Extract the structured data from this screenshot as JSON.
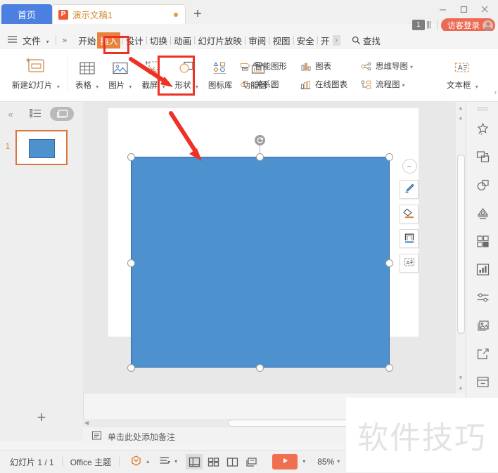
{
  "window": {
    "tabs": [
      {
        "label": "首页",
        "type": "home"
      },
      {
        "label": "演示文稿1",
        "type": "document",
        "icon": "wps-presentation-icon"
      }
    ],
    "new_tab_label": "+",
    "controls": {
      "minimize": "—",
      "maximize": "▢",
      "close": "✕"
    },
    "account_badge": "1",
    "login_label": "访客登录"
  },
  "menubar": {
    "file_label": "文件",
    "overflow_label": "»",
    "ribbon_tabs": [
      {
        "label": "开始",
        "selected": false
      },
      {
        "label": "插入",
        "selected": true
      },
      {
        "label": "设计",
        "selected": false
      },
      {
        "label": "切换",
        "selected": false
      },
      {
        "label": "动画",
        "selected": false
      },
      {
        "label": "幻灯片放映",
        "selected": false
      },
      {
        "label": "审阅",
        "selected": false
      },
      {
        "label": "视图",
        "selected": false
      },
      {
        "label": "安全",
        "selected": false
      },
      {
        "label": "开",
        "selected": false
      }
    ],
    "more_tabs_label": "›",
    "find_label": "查找",
    "right_icons": [
      "cloud-sync-icon",
      "share-icon",
      "collaborate-icon",
      "help-icon",
      "more-icon",
      "collapse-ribbon-icon"
    ]
  },
  "ribbon": {
    "groups": [
      {
        "items": [
          {
            "label": "新建幻灯片",
            "icon": "new-slide-icon",
            "dropdown": true,
            "size": "big"
          }
        ]
      },
      {
        "items": [
          {
            "label": "表格",
            "icon": "table-icon",
            "dropdown": true,
            "size": "big"
          },
          {
            "label": "图片",
            "icon": "picture-icon",
            "dropdown": true,
            "size": "big"
          },
          {
            "label": "截屏",
            "icon": "screenshot-icon",
            "dropdown": true,
            "size": "big"
          },
          {
            "label": "形状",
            "icon": "shapes-icon",
            "dropdown": true,
            "size": "big",
            "highlighted": true
          },
          {
            "label": "图标库",
            "icon": "icon-library-icon",
            "dropdown": false,
            "size": "big"
          },
          {
            "label": "功能图",
            "icon": "function-chart-icon",
            "dropdown": true,
            "size": "big"
          }
        ]
      },
      {
        "items": [
          {
            "label": "智能图形",
            "icon": "smartart-icon",
            "size": "small"
          },
          {
            "label": "关系图",
            "icon": "relationship-chart-icon",
            "size": "small"
          },
          {
            "label": "图表",
            "icon": "chart-icon",
            "size": "small"
          },
          {
            "label": "在线图表",
            "icon": "online-chart-icon",
            "size": "small"
          },
          {
            "label": "思维导图",
            "icon": "mindmap-icon",
            "dropdown": true,
            "size": "small"
          },
          {
            "label": "流程图",
            "icon": "flowchart-icon",
            "dropdown": true,
            "size": "small"
          },
          {
            "label": "文本框",
            "icon": "textbox-icon",
            "dropdown": true,
            "size": "big"
          }
        ]
      }
    ],
    "expand_label": "›"
  },
  "slide_panel": {
    "collapse_label": "«",
    "outline_icon": "outline-view-icon",
    "slides_icon": "slides-view-icon",
    "slides": [
      {
        "number": "1",
        "selected": true
      }
    ],
    "add_slide_label": "+"
  },
  "canvas": {
    "shape": {
      "name": "rectangle",
      "fill": "#4e91cf",
      "stroke": "#2d6ca3"
    },
    "rotate_handle_icon": "rotate-icon",
    "mini_toolbar": {
      "close_label": "−",
      "buttons": [
        {
          "icon": "fill-brush-icon",
          "name": "shape-fill-button"
        },
        {
          "icon": "outline-pen-icon",
          "name": "shape-outline-button"
        },
        {
          "icon": "shape-style-icon",
          "name": "shape-style-button"
        },
        {
          "icon": "text-frame-icon",
          "name": "text-frame-button"
        }
      ]
    }
  },
  "notes": {
    "icon": "notes-icon",
    "placeholder": "单击此处添加备注"
  },
  "right_sidebar": {
    "items": [
      {
        "icon": "magic-wand-icon",
        "name": "beautify"
      },
      {
        "icon": "swap-icon",
        "name": "replace"
      },
      {
        "icon": "shapes-overlap-icon",
        "name": "shapes"
      },
      {
        "icon": "design-icon",
        "name": "design"
      },
      {
        "icon": "grid-icon",
        "name": "elements"
      },
      {
        "icon": "chart-bar-icon",
        "name": "charts"
      },
      {
        "icon": "sliders-icon",
        "name": "adjust"
      },
      {
        "icon": "image-stack-icon",
        "name": "media"
      },
      {
        "icon": "export-icon",
        "name": "export"
      },
      {
        "icon": "archive-icon",
        "name": "archive"
      },
      {
        "icon": "picture-frame-icon",
        "name": "pictures"
      }
    ]
  },
  "statusbar": {
    "slide_count": "幻灯片 1 / 1",
    "theme": "Office 主题",
    "theme_icon": "theme-icon",
    "language_icon": "language-icon",
    "views": [
      {
        "icon": "normal-view-icon",
        "name": "normal-view",
        "active": true
      },
      {
        "icon": "slide-sorter-icon",
        "name": "slide-sorter-view",
        "active": false
      },
      {
        "icon": "reading-view-icon",
        "name": "reading-view",
        "active": false
      },
      {
        "icon": "notes-view-icon",
        "name": "notes-view",
        "active": false
      }
    ],
    "play_icon": "play-icon",
    "zoom_level": "85%",
    "zoom_out_label": "—"
  },
  "annotations": {
    "red_boxes": [
      {
        "target": "插入 ribbon tab"
      },
      {
        "target": "形状 button"
      }
    ],
    "red_arrows": [
      {
        "from": "upper-left",
        "to": "形状 button"
      },
      {
        "from": "ribbon",
        "to": "canvas shape"
      }
    ]
  },
  "watermark": {
    "text": "软件技巧"
  }
}
